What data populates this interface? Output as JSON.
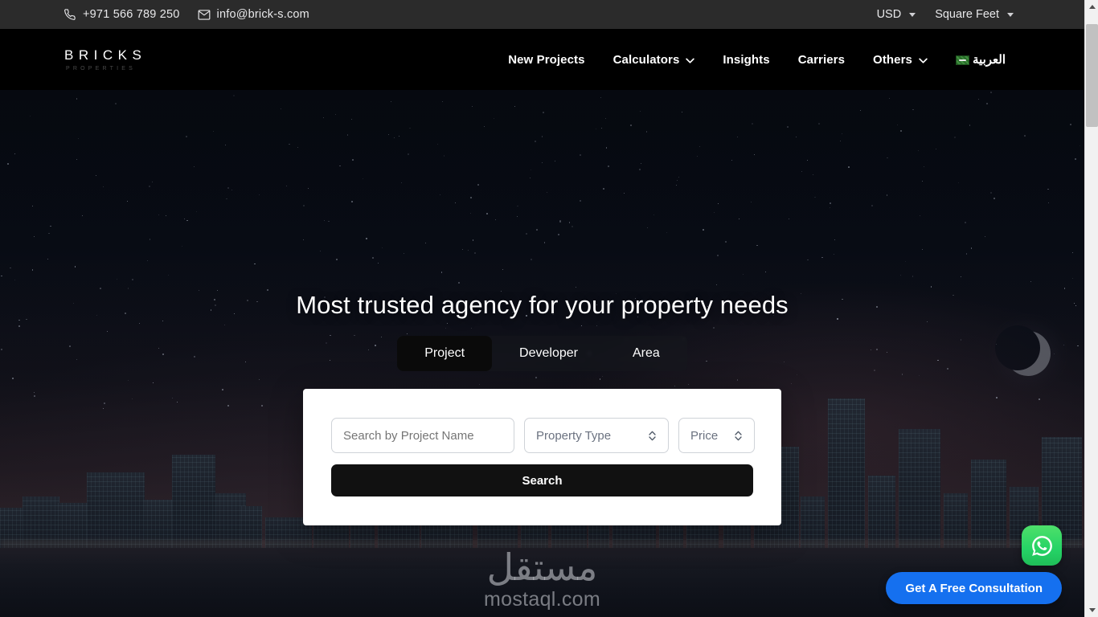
{
  "topbar": {
    "phone": "+971 566 789 250",
    "email": "info@brick-s.com",
    "phone_icon": "phone-icon",
    "email_icon": "envelope-icon",
    "currency": "USD",
    "unit": "Square Feet"
  },
  "nav": {
    "logo_brand": "BRICKS",
    "logo_sub": "PROPERTIES",
    "links": [
      {
        "label": "New Projects",
        "has_chevron": false
      },
      {
        "label": "Calculators",
        "has_chevron": true
      },
      {
        "label": "Insights",
        "has_chevron": false
      },
      {
        "label": "Carriers",
        "has_chevron": false
      },
      {
        "label": "Others",
        "has_chevron": true
      }
    ],
    "language": "العربية"
  },
  "hero": {
    "title": "Most trusted agency for your property needs",
    "tabs": [
      {
        "label": "Project",
        "active": true
      },
      {
        "label": "Developer",
        "active": false
      },
      {
        "label": "Area",
        "active": false
      }
    ],
    "search": {
      "name_placeholder": "Search by Project Name",
      "name_value": "",
      "property_type_label": "Property Type",
      "price_label": "Price",
      "search_button": "Search"
    }
  },
  "watermark": {
    "arabic": "مستقل",
    "latin": "mostaql.com"
  },
  "floating": {
    "whatsapp_icon": "whatsapp-icon",
    "consultation_label": "Get A Free Consultation",
    "consultation_color": "#1570ef",
    "whatsapp_color": "#25d366"
  },
  "colors": {
    "topbar_bg": "#2b2b2b",
    "nav_bg": "#000000",
    "card_bg": "#ffffff",
    "button_dark": "#111111",
    "text_light": "#ffffff"
  },
  "scrollbar": {
    "up_icon": "triangle-up-icon",
    "down_icon": "triangle-down-icon"
  }
}
